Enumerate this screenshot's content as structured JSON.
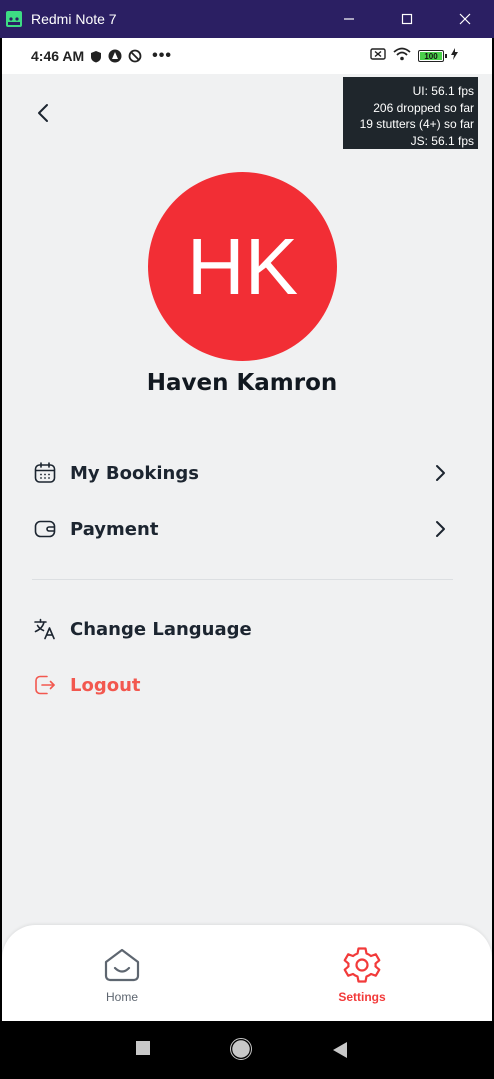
{
  "window": {
    "title": "Redmi Note 7"
  },
  "statusbar": {
    "time": "4:46 AM",
    "battery_level": "100"
  },
  "perf_monitor": {
    "ui_fps": "UI: 56.1 fps",
    "dropped": "206 dropped so far",
    "stutters": "19 stutters (4+) so far",
    "js_fps": "JS: 56.1 fps"
  },
  "profile": {
    "initials": "HK",
    "name": "Haven Kamron",
    "avatar_color": "#f22e35"
  },
  "menu": {
    "my_bookings": "My Bookings",
    "payment": "Payment",
    "change_language": "Change Language",
    "logout": "Logout"
  },
  "tabs": {
    "home": "Home",
    "settings": "Settings",
    "active": "Settings"
  },
  "colors": {
    "accent": "#f23a3a",
    "logout": "#f2584f"
  }
}
